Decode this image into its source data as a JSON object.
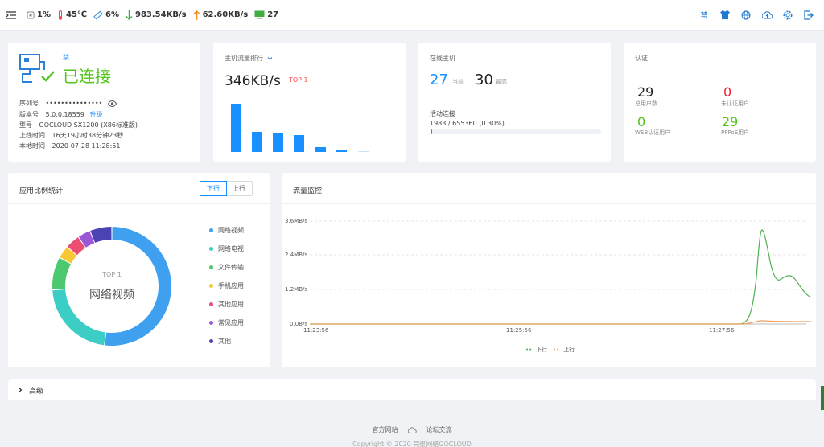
{
  "topbar": {
    "cpu": "1%",
    "temp": "45℃",
    "mem": "6%",
    "down": "983.54KB/s",
    "up": "62.60KB/s",
    "hosts": "27"
  },
  "status": {
    "badge": "禁",
    "connected": "已连接",
    "serial_label": "序列号",
    "serial_value": "•••••••••••••••",
    "version_label": "版本号",
    "version_value": "5.0.0.18559",
    "upgrade": "升级",
    "model_label": "型号",
    "model_value": "GOCLOUD SX1200 (X86标准版)",
    "uptime_label": "上线时间",
    "uptime_value": "16天19小时38分钟23秒",
    "localtime_label": "本地时间",
    "localtime_value": "2020-07-28 11:28:51"
  },
  "host_rank": {
    "title": "主机流量排行",
    "rate": "346KB/s",
    "top": "TOP 1",
    "bars": [
      1.0,
      0.42,
      0.4,
      0.35,
      0.1,
      0.05,
      0.02
    ]
  },
  "online_hosts": {
    "title": "在线主机",
    "current": "27",
    "current_label": "当前",
    "max": "30",
    "max_label": "最高",
    "conn_label": "活动连接",
    "conn_value": "1983 / 655360 (0.30%)",
    "conn_progress": 0.003
  },
  "auth": {
    "title": "认证",
    "total": "29",
    "total_label": "总用户数",
    "unauth": "0",
    "unauth_label": "未认证用户",
    "web": "0",
    "web_label": "WEB认证用户",
    "pppoe": "29",
    "pppoe_label": "PPPoE用户"
  },
  "app_ratio": {
    "title": "应用比例统计",
    "tab_down": "下行",
    "tab_up": "上行",
    "center_top": "TOP 1",
    "center_label": "网络视频",
    "legend": [
      {
        "name": "网络视频",
        "color": "#3fa0f0",
        "value": 52
      },
      {
        "name": "网络电视",
        "color": "#3ccdc5",
        "value": 22
      },
      {
        "name": "文件传输",
        "color": "#4cc96e",
        "value": 9
      },
      {
        "name": "手机应用",
        "color": "#f8c834",
        "value": 3.5
      },
      {
        "name": "其他应用",
        "color": "#ec4d72",
        "value": 4
      },
      {
        "name": "常见应用",
        "color": "#9b57d8",
        "value": 3.5
      },
      {
        "name": "其他",
        "color": "#4a43b4",
        "value": 6
      }
    ]
  },
  "traffic": {
    "title": "流量监控",
    "y_ticks": [
      "3.6MB/s",
      "2.4MB/s",
      "1.2MB/s",
      "0.0B/s"
    ],
    "x_ticks": [
      "11:23:56",
      "11:25:56",
      "11:27:56"
    ],
    "legend_down": "下行",
    "legend_up": "上行",
    "down_color": "#52b052",
    "up_color": "#f0a060"
  },
  "advanced": {
    "label": "高级"
  },
  "footer": {
    "link1": "官方网站",
    "link2": "论坛交流",
    "copyright": "Copyright © 2020 完维网络GOCLOUD"
  }
}
